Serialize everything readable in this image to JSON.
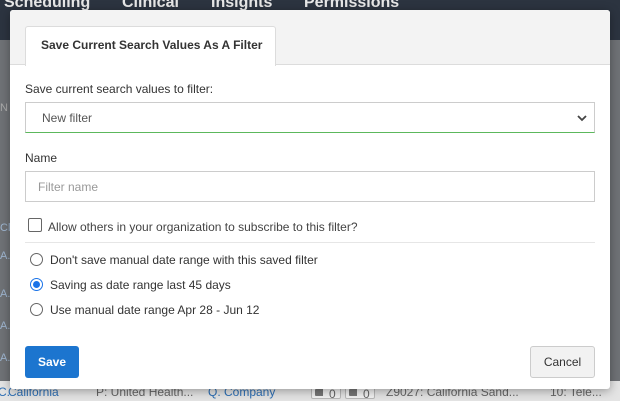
{
  "background": {
    "nav_items": [
      "Scheduling",
      "Clinical",
      "Insights",
      "Permissions"
    ],
    "left_fragments": [
      "N",
      "Cli",
      "A.",
      "A.",
      "A.",
      "A."
    ],
    "bottom_row": {
      "col1": "California",
      "col1_prefix": "C.",
      "col2": "P: United Health...",
      "col3": "Q. Company",
      "tag1_count": "0",
      "tag2_count": "0",
      "col4": "Z9027: California Sand...",
      "col5": "10: Tele..."
    }
  },
  "modal": {
    "tab_label": "Save Current Search Values As A Filter",
    "select_label": "Save current search values to filter:",
    "select_value": "New filter",
    "name_label": "Name",
    "name_placeholder": "Filter name",
    "name_value": "",
    "share_label": "Allow others in your organization to subscribe to this filter?",
    "share_checked": false,
    "date_options": [
      {
        "label": "Don't save manual date range with this saved filter",
        "selected": false
      },
      {
        "label": "Saving as date range last 45 days",
        "selected": true
      },
      {
        "label": "Use manual date range Apr 28 - Jun 12",
        "selected": false
      }
    ],
    "save_label": "Save",
    "cancel_label": "Cancel",
    "colors": {
      "primary": "#1c75cf",
      "radio_accent": "#1a73e8",
      "valid_border": "#5cb85c"
    }
  }
}
